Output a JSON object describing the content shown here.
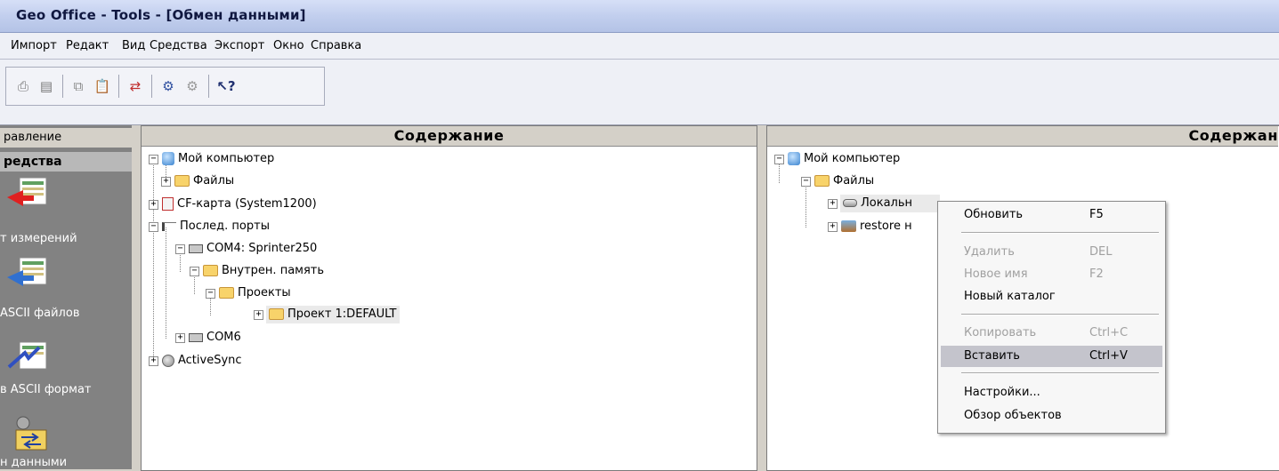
{
  "window": {
    "title": "Geo Office - Tools - [Обмен данными]"
  },
  "menu": [
    "Импорт",
    "Редакт",
    "Вид",
    "Средства",
    "Экспорт",
    "Окно",
    "Справка"
  ],
  "toolbar": {
    "buttons": [
      "print-icon",
      "print-preview-icon",
      "copy-icon",
      "paste-icon",
      "data-exchange-icon",
      "connect-icon",
      "disconnect-icon",
      "context-help-icon"
    ]
  },
  "sidebar": {
    "header": "равление",
    "section": "редства",
    "items": [
      {
        "label": "т измерений",
        "icon": "import-measurements-icon"
      },
      {
        "label": "ASCII файлов",
        "icon": "import-ascii-icon"
      },
      {
        "label": "в ASCII формат",
        "icon": "export-ascii-icon"
      },
      {
        "label": "н данными",
        "icon": "data-exchange-icon"
      }
    ]
  },
  "left_panel": {
    "title": "Содержание",
    "tree": [
      {
        "label": "Мой компьютер",
        "icon": "computer-icon",
        "toggle": "−"
      },
      {
        "label": "Файлы",
        "icon": "folder-icon",
        "toggle": "+"
      },
      {
        "label": "CF-карта (System1200)",
        "icon": "card-icon",
        "toggle": "+"
      },
      {
        "label": "Послед. порты",
        "icon": "serial-port-icon",
        "toggle": "−"
      },
      {
        "label": "COM4: Sprinter250",
        "icon": "port-icon",
        "toggle": "−"
      },
      {
        "label": "Внутрен. память",
        "icon": "folder-icon",
        "toggle": "−"
      },
      {
        "label": "Проекты",
        "icon": "folder-icon",
        "toggle": "−"
      },
      {
        "label": "Проект 1:DEFAULT",
        "icon": "folder-icon",
        "toggle": "+"
      },
      {
        "label": "COM6",
        "icon": "port-icon",
        "toggle": "+"
      },
      {
        "label": "ActiveSync",
        "icon": "activesync-icon",
        "toggle": "+"
      }
    ]
  },
  "right_panel": {
    "title": "Содержан",
    "tree": [
      {
        "label": "Мой компьютер",
        "icon": "computer-icon",
        "toggle": "−"
      },
      {
        "label": "Файлы",
        "icon": "folder-icon",
        "toggle": "−"
      },
      {
        "label": "Локальн",
        "icon": "disk-icon",
        "toggle": "+"
      },
      {
        "label": "restore н",
        "icon": "network-drive-icon",
        "toggle": "+"
      }
    ]
  },
  "context_menu": {
    "items": [
      {
        "label": "Обновить",
        "shortcut": "F5",
        "enabled": true
      },
      {
        "label": "Удалить",
        "shortcut": "DEL",
        "enabled": false
      },
      {
        "label": "Новое имя",
        "shortcut": "F2",
        "enabled": false
      },
      {
        "label": "Новый каталог",
        "shortcut": "",
        "enabled": true
      },
      {
        "label": "Копировать",
        "shortcut": "Ctrl+C",
        "enabled": false
      },
      {
        "label": "Вставить",
        "shortcut": "Ctrl+V",
        "enabled": true,
        "highlighted": true
      },
      {
        "label": "Настройки...",
        "shortcut": "",
        "enabled": true
      },
      {
        "label": "Обзор объектов",
        "shortcut": "",
        "enabled": true
      }
    ]
  }
}
